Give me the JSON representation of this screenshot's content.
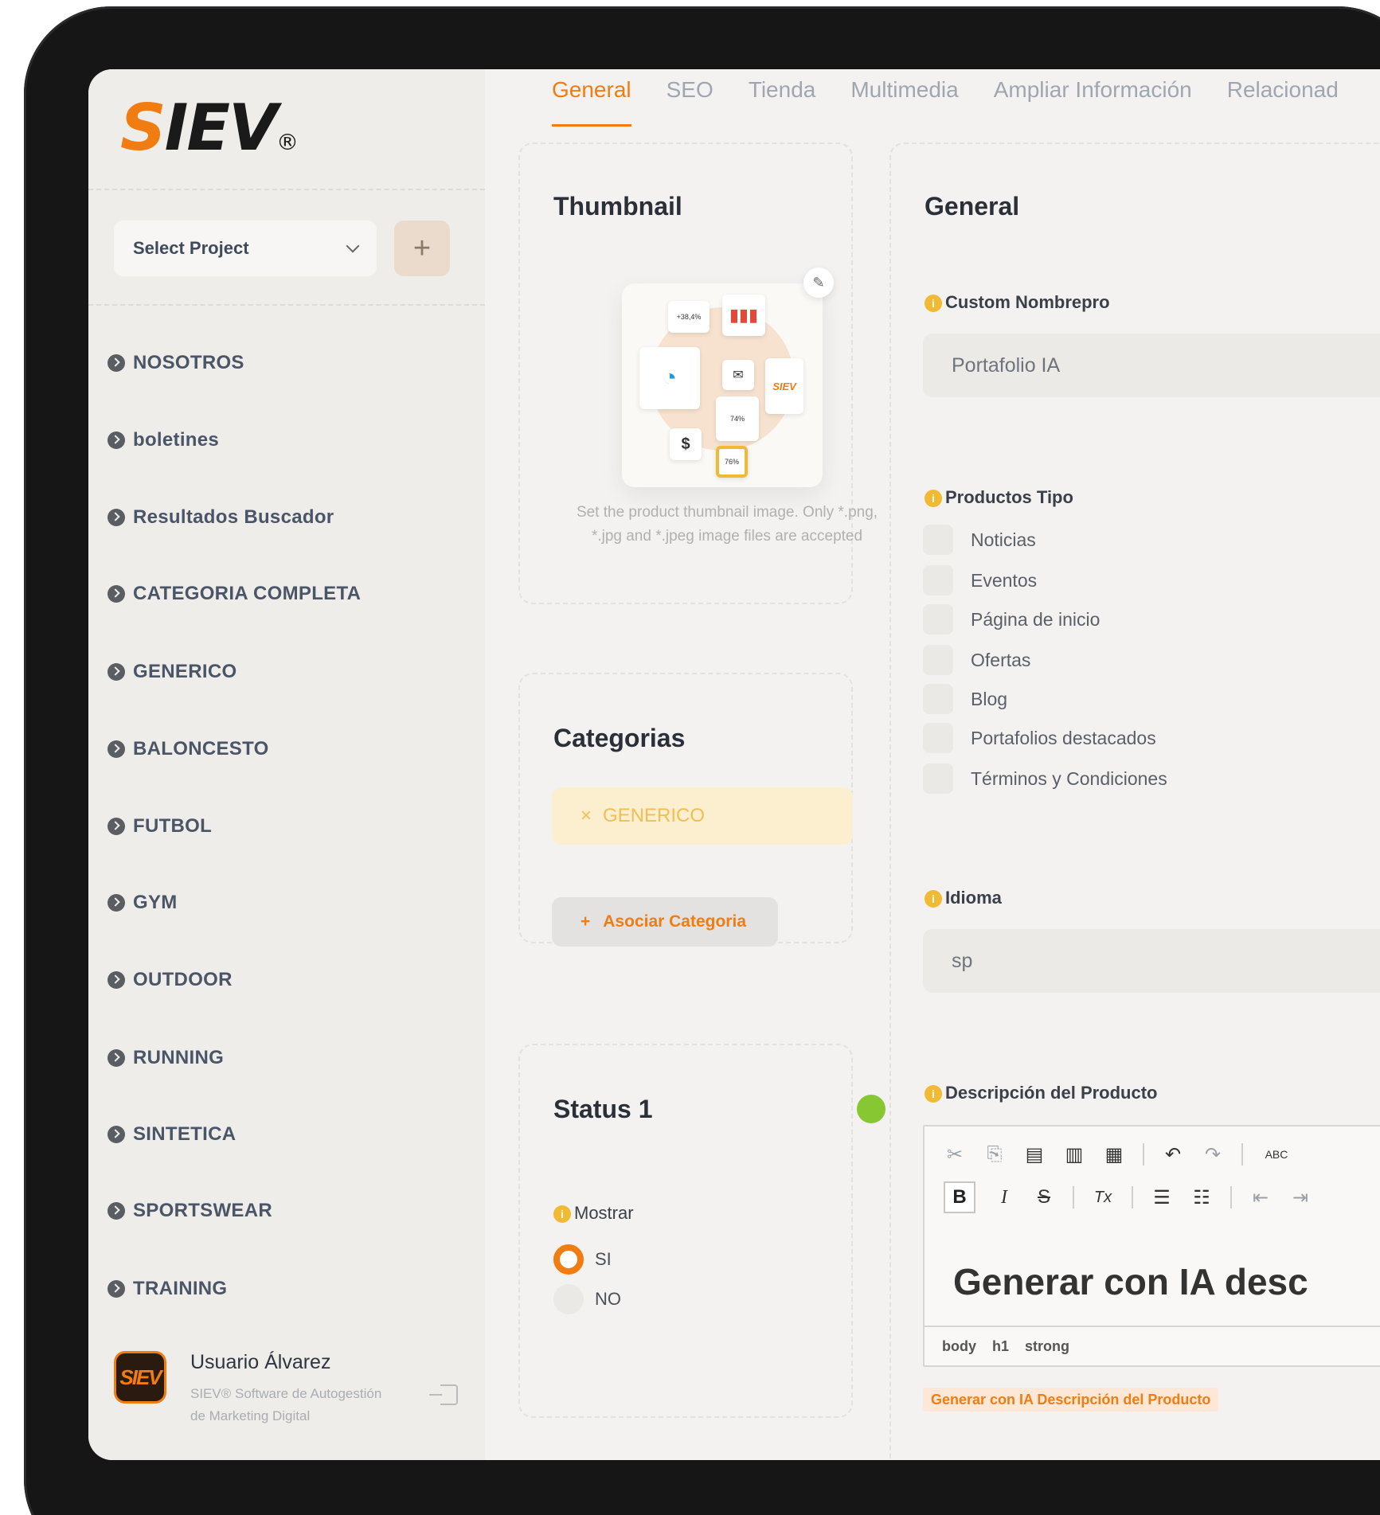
{
  "brand": {
    "logo_s": "S",
    "logo_rest": "IEV",
    "logo_reg": "®",
    "accent": "#f07c12"
  },
  "sidebar": {
    "select_project": "Select Project",
    "add_project_icon": "+",
    "items": [
      {
        "label": "NOSOTROS"
      },
      {
        "label": "boletines"
      },
      {
        "label": "Resultados Buscador"
      },
      {
        "label": "CATEGORIA COMPLETA"
      },
      {
        "label": "GENERICO"
      },
      {
        "label": "BALONCESTO"
      },
      {
        "label": "FUTBOL"
      },
      {
        "label": "GYM"
      },
      {
        "label": "OUTDOOR"
      },
      {
        "label": "RUNNING"
      },
      {
        "label": "SINTETICA"
      },
      {
        "label": "SPORTSWEAR"
      },
      {
        "label": "TRAINING"
      }
    ],
    "user": {
      "avatar_text": "SIEV",
      "name": "Usuario Álvarez",
      "description": "SIEV® Software de Autogestión de Marketing Digital"
    }
  },
  "tabs": [
    {
      "label": "General",
      "active": true
    },
    {
      "label": "SEO"
    },
    {
      "label": "Tienda"
    },
    {
      "label": "Multimedia"
    },
    {
      "label": "Ampliar Información"
    },
    {
      "label": "Relacionad"
    }
  ],
  "thumbnail": {
    "title": "Thumbnail",
    "help": "Set the product thumbnail image. Only *.png, *.jpg and *.jpeg image files are accepted",
    "mini_percent_1": "+38,4%",
    "mini_percent_2": "74%",
    "mini_percent_3": "76%",
    "mini_logo": "SIEV",
    "mini_dollar": "$"
  },
  "categorias": {
    "title": "Categorias",
    "tag_x": "×",
    "tag": "GENERICO",
    "assoc_icon": "+",
    "assoc_label": "Asociar Categoria"
  },
  "status": {
    "title": "Status 1",
    "status_color": "#86c732",
    "mostrar_label": "Mostrar",
    "options": [
      {
        "label": "SI",
        "selected": true
      },
      {
        "label": "NO",
        "selected": false
      }
    ]
  },
  "general": {
    "title": "General",
    "info_icon": "i",
    "nombre_label": "Custom Nombrepro",
    "nombre_value": "Portafolio IA",
    "tipo_label": "Productos Tipo",
    "tipos": [
      {
        "label": "Noticias"
      },
      {
        "label": "Eventos"
      },
      {
        "label": "Página de inicio"
      },
      {
        "label": "Ofertas"
      },
      {
        "label": "Blog"
      },
      {
        "label": "Portafolios destacados"
      },
      {
        "label": "Términos y Condiciones"
      }
    ],
    "idioma_label": "Idioma",
    "idioma_value": "sp",
    "desc_label": "Descripción del Producto",
    "editor_text": "Generar con IA desc",
    "editor_tags": [
      "body",
      "h1",
      "strong"
    ],
    "generate_link": "Generar con IA Descripción del Producto",
    "toolbar": {
      "bold": "B",
      "italic": "I",
      "strike": "S",
      "clear": "Tx",
      "spell": "ABC"
    }
  }
}
